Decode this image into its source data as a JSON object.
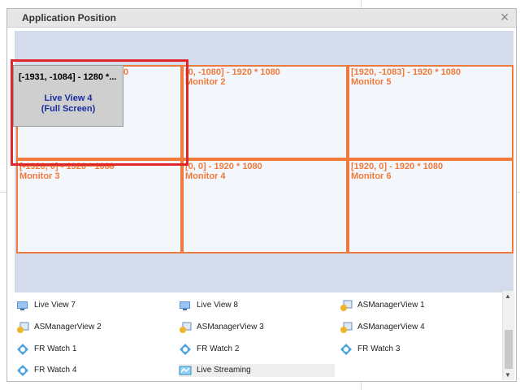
{
  "dialog": {
    "title": "Application Position"
  },
  "monitors": [
    {
      "id": "m1",
      "res": "0",
      "name": ""
    },
    {
      "id": "m2",
      "res": "[0, -1080] - 1920 * 1080",
      "name": "Monitor 2"
    },
    {
      "id": "m5",
      "res": "[1920, -1083] - 1920 * 1080",
      "name": "Monitor 5"
    },
    {
      "id": "m3",
      "res": "[-1920, 0] - 1920 * 1080",
      "name": "Monitor 3"
    },
    {
      "id": "m4",
      "res": "[0, 0] - 1920 * 1080",
      "name": "Monitor 4"
    },
    {
      "id": "m6",
      "res": "[1920, 0] - 1920 * 1080",
      "name": "Monitor 6"
    }
  ],
  "app_window": {
    "position": "[-1931, -1084] - 1280 *...",
    "name_line1": "Live View 4",
    "name_line2": "(Full Screen)"
  },
  "list": [
    {
      "label": "Live View 7",
      "icon": "live-view-icon"
    },
    {
      "label": "Live View 8",
      "icon": "live-view-icon"
    },
    {
      "label": "ASManagerView 1",
      "icon": "asmanager-icon"
    },
    {
      "label": "ASManagerView 2",
      "icon": "asmanager-icon"
    },
    {
      "label": "ASManagerView 3",
      "icon": "asmanager-icon"
    },
    {
      "label": "ASManagerView 4",
      "icon": "asmanager-icon"
    },
    {
      "label": "FR Watch 1",
      "icon": "fr-watch-icon"
    },
    {
      "label": "FR Watch 2",
      "icon": "fr-watch-icon"
    },
    {
      "label": "FR Watch 3",
      "icon": "fr-watch-icon"
    },
    {
      "label": "FR Watch 4",
      "icon": "fr-watch-icon"
    },
    {
      "label": "Live Streaming",
      "icon": "live-streaming-icon"
    }
  ],
  "colors": {
    "monitor_border": "#f07a3c",
    "highlight": "#e0262a",
    "app_name": "#1a2da0",
    "canvas": "#d4dceb"
  }
}
